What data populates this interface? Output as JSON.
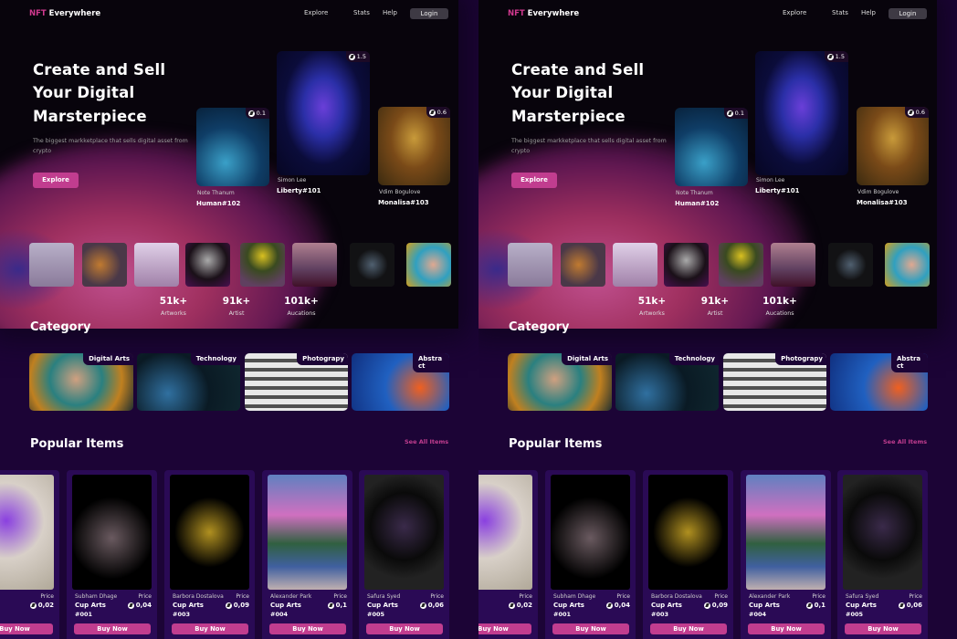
{
  "nav": {
    "logo_accent": "NFT",
    "logo_rest": " Everywhere",
    "links": [
      "Explore",
      "Stats",
      "Help"
    ],
    "login": "Login"
  },
  "hero": {
    "title_lines": [
      "Create and Sell",
      "Your Digital",
      "Marsterpiece"
    ],
    "subtitle": "The biggest markketplace that sells digital asset from crypto",
    "cta": "Explore",
    "cards": [
      {
        "artist": "Note Thanum",
        "title": "Human#102",
        "price": "0.1"
      },
      {
        "artist": "Simon Lee",
        "title": "Liberty#101",
        "price": "1.5"
      },
      {
        "artist": "Vdim Bogulove",
        "title": "Monalisa#103",
        "price": "0.6"
      }
    ]
  },
  "stats": [
    {
      "value": "51k+",
      "label": "Artworks"
    },
    {
      "value": "91k+",
      "label": "Artist"
    },
    {
      "value": "101k+",
      "label": "Aucations"
    }
  ],
  "category": {
    "title": "Category",
    "items": [
      "Digital Arts",
      "Technology",
      "Photograpy",
      "Abstract"
    ]
  },
  "popular": {
    "title": "Popular Items",
    "see_all": "See  All Items",
    "price_label": "Price",
    "buy_label": "Buy Now",
    "items": [
      {
        "artist": "…ones",
        "title": "…rts",
        "id": "",
        "price": "0,02"
      },
      {
        "artist": "Subham Dhage",
        "title": "Cup Arts",
        "id": "#001",
        "price": "0,04"
      },
      {
        "artist": "Barbora Dostalova",
        "title": "Cup Arts",
        "id": "#003",
        "price": "0,09"
      },
      {
        "artist": "Alexander Park",
        "title": "Cup Arts",
        "id": "#004",
        "price": "0,1"
      },
      {
        "artist": "Safura Syed",
        "title": "Cup Arts",
        "id": "#005",
        "price": "0,06"
      }
    ]
  },
  "colors": {
    "accent": "#c13d8f",
    "background": "#1c0436",
    "hero_bg": "#08040c",
    "card_bg": "#2a0a55"
  }
}
